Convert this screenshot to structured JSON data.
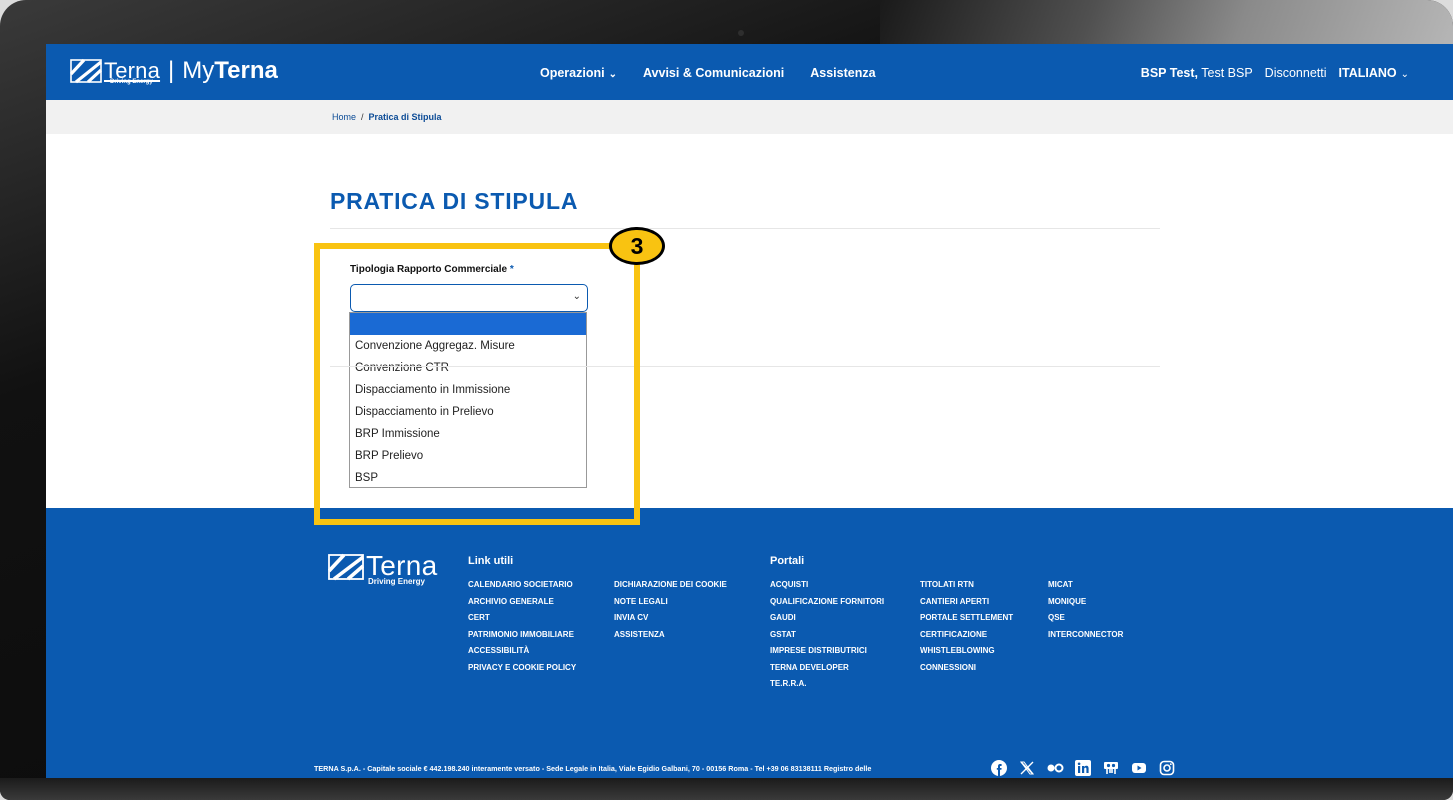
{
  "header": {
    "logo_brand": "Terna",
    "logo_tagline": "Driving Energy",
    "logo_sep": "|",
    "logo_my": "My",
    "logo_my_bold": "Terna",
    "nav": [
      {
        "label": "Operazioni",
        "has_dropdown": true
      },
      {
        "label": "Avvisi & Comunicazioni",
        "has_dropdown": false
      },
      {
        "label": "Assistenza",
        "has_dropdown": false
      }
    ],
    "user_bold": "BSP Test,",
    "user_name": "Test BSP",
    "logout": "Disconnetti",
    "language": "ITALIANO"
  },
  "breadcrumb": {
    "home": "Home",
    "separator": "/",
    "current": "Pratica di Stipula"
  },
  "page_title": "PRATICA DI STIPULA",
  "form": {
    "label": "Tipologia Rapporto Commerciale",
    "required_mark": "*",
    "selected_value": "",
    "options": [
      "",
      "Convenzione Aggregaz. Misure",
      "Convenzione CTR",
      "Dispacciamento in Immissione",
      "Dispacciamento in Prelievo",
      "BRP Immissione",
      "BRP Prelievo",
      "BSP"
    ]
  },
  "annotation": {
    "step_number": "3",
    "color": "#f9c311"
  },
  "footer": {
    "brand": "Terna",
    "tagline": "Driving Energy",
    "link_utili_title": "Link utili",
    "link_utili_col1": [
      "CALENDARIO SOCIETARIO",
      "ARCHIVIO GENERALE",
      "CERT",
      "PATRIMONIO IMMOBILIARE",
      "ACCESSIBILITÀ",
      "PRIVACY E COOKIE POLICY"
    ],
    "link_utili_col2": [
      "DICHIARAZIONE DEI COOKIE",
      "NOTE LEGALI",
      "INVIA CV",
      "ASSISTENZA"
    ],
    "portali_title": "Portali",
    "portali_col1": [
      "ACQUISTI",
      "QUALIFICAZIONE FORNITORI",
      "GAUDI",
      "GSTAT",
      "IMPRESE DISTRIBUTRICI",
      "TERNA DEVELOPER",
      "TE.R.R.A."
    ],
    "portali_col2": [
      "TITOLATI RTN",
      "CANTIERI APERTI",
      "PORTALE SETTLEMENT",
      "CERTIFICAZIONE",
      "WHISTLEBLOWING",
      "CONNESSIONI"
    ],
    "portali_col3": [
      "MICAT",
      "MONIQUE",
      "QSE",
      "INTERCONNECTOR"
    ],
    "legal": "TERNA S.p.A. - Capitale sociale € 442.198.240 interamente versato - Sede Legale in Italia, Viale Egidio Galbani, 70 - 00156 Roma - Tel +39 06 83138111 Registro delle",
    "social_icons": [
      "facebook-icon",
      "x-icon",
      "flickr-icon",
      "linkedin-icon",
      "slideshare-icon",
      "youtube-icon",
      "instagram-icon"
    ]
  },
  "colors": {
    "primary": "#0b5ab0",
    "highlight": "#f9c311",
    "selected_option": "#1a6ad4"
  }
}
